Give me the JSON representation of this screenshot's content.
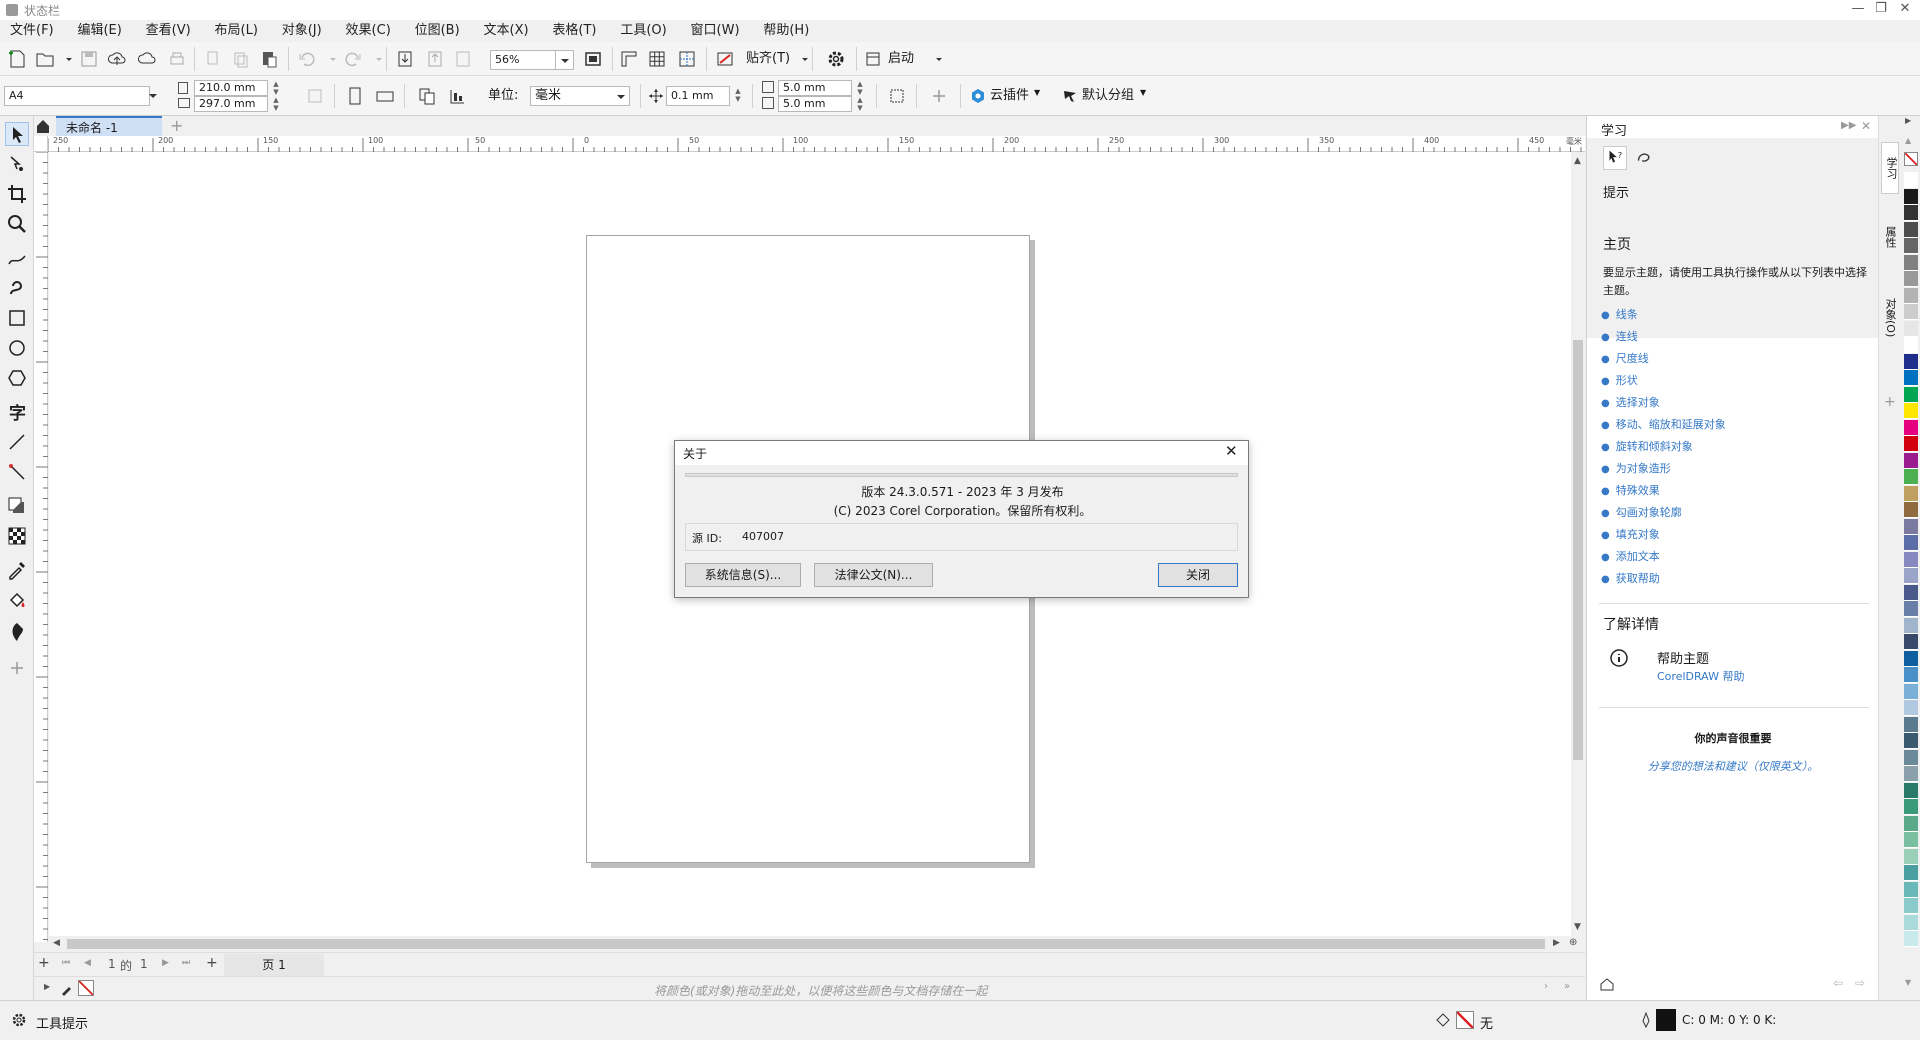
{
  "window": {
    "title": "状态栏"
  },
  "menu": [
    "文件(F)",
    "编辑(E)",
    "查看(V)",
    "布局(L)",
    "对象(J)",
    "效果(C)",
    "位图(B)",
    "文本(X)",
    "表格(T)",
    "工具(O)",
    "窗口(W)",
    "帮助(H)"
  ],
  "toolbar1": {
    "zoom": "56%",
    "snap_label": "贴齐(T)",
    "launch_label": "启动"
  },
  "toolbar2": {
    "page_size": "A4",
    "width": "210.0 mm",
    "height": "297.0 mm",
    "unit_label": "单位:",
    "unit_value": "毫米",
    "nudge": "0.1 mm",
    "dup_x": "5.0 mm",
    "dup_y": "5.0 mm",
    "cloud_label": "云插件",
    "group_label": "默认分组"
  },
  "doc_tab": {
    "name": "未命名 -1"
  },
  "ruler": {
    "h_ticks": [
      "250",
      "200",
      "150",
      "100",
      "50",
      "0",
      "50",
      "100",
      "150",
      "200",
      "250",
      "300",
      "350",
      "400",
      "450"
    ],
    "unit": "毫米"
  },
  "pagenav": {
    "current": "1",
    "of_label": "的",
    "total": "1",
    "page_tab": "页 1"
  },
  "colorbar": {
    "hint": "将颜色(或对象)拖动至此处，以便将这些颜色与文档存储在一起"
  },
  "status": {
    "tool_hint": "工具提示",
    "fill_label": "无",
    "cmyk": "C: 0 M: 0 Y: 0 K:"
  },
  "about_dialog": {
    "title": "关于",
    "version_line": "版本 24.3.0.571 - 2023 年 3 月发布",
    "copyright_line": "(C) 2023 Corel Corporation。保留所有权利。",
    "source_id_label": "源 ID:",
    "source_id_value": "407007",
    "sysinfo_button": "系统信息(S)...",
    "legal_button": "法律公文(N)...",
    "close_button": "关闭"
  },
  "docker": {
    "title": "学习",
    "section": "提示",
    "home_heading": "主页",
    "home_desc": "要显示主题，请使用工具执行操作或从以下列表中选择主题。",
    "topics": [
      "线条",
      "连线",
      "尺度线",
      "形状",
      "选择对象",
      "移动、缩放和延展对象",
      "旋转和倾斜对象",
      "为对象造形",
      "特殊效果",
      "勾画对象轮廓",
      "填充对象",
      "添加文本",
      "获取帮助"
    ],
    "learn_more": "了解详情",
    "help_topic": "帮助主题",
    "help_link": "CorelDRAW 帮助",
    "feedback_heading": "你的声音很重要",
    "feedback_link": "分享您的想法和建议（仅限英文）。"
  },
  "docker_tabs": [
    "学习",
    "属性",
    "对象(O)"
  ],
  "palette_colors": [
    "#ffffff",
    "#1a1a1a",
    "#333333",
    "#4d4d4d",
    "#666666",
    "#808080",
    "#999999",
    "#b3b3b3",
    "#cccccc",
    "#e6e6e6",
    "#ffffff",
    "#1f2d8c",
    "#0070c0",
    "#00a651",
    "#ffe600",
    "#e4007f",
    "#d2000f",
    "#9b1c8e",
    "#4caf50",
    "#c0a060",
    "#8f6b3f",
    "#7a7aa0",
    "#5b6ea8",
    "#8888c0",
    "#9aa3c8",
    "#4a5a8a",
    "#6a7fa8",
    "#a0b4cc",
    "#3a4a6a",
    "#0f5fa0",
    "#4a90c8",
    "#7ab0d8",
    "#b0c8e0",
    "#5a7a90",
    "#3a5a70",
    "#6a8a9a",
    "#8aa0aa",
    "#2a7a6a",
    "#3a9a7a",
    "#5aaa8a",
    "#7ac0a0",
    "#9ad0b8",
    "#4aa0a0",
    "#6ab8b8",
    "#8acaca",
    "#aadada",
    "#c8eaea"
  ],
  "accent": "#3478c6"
}
